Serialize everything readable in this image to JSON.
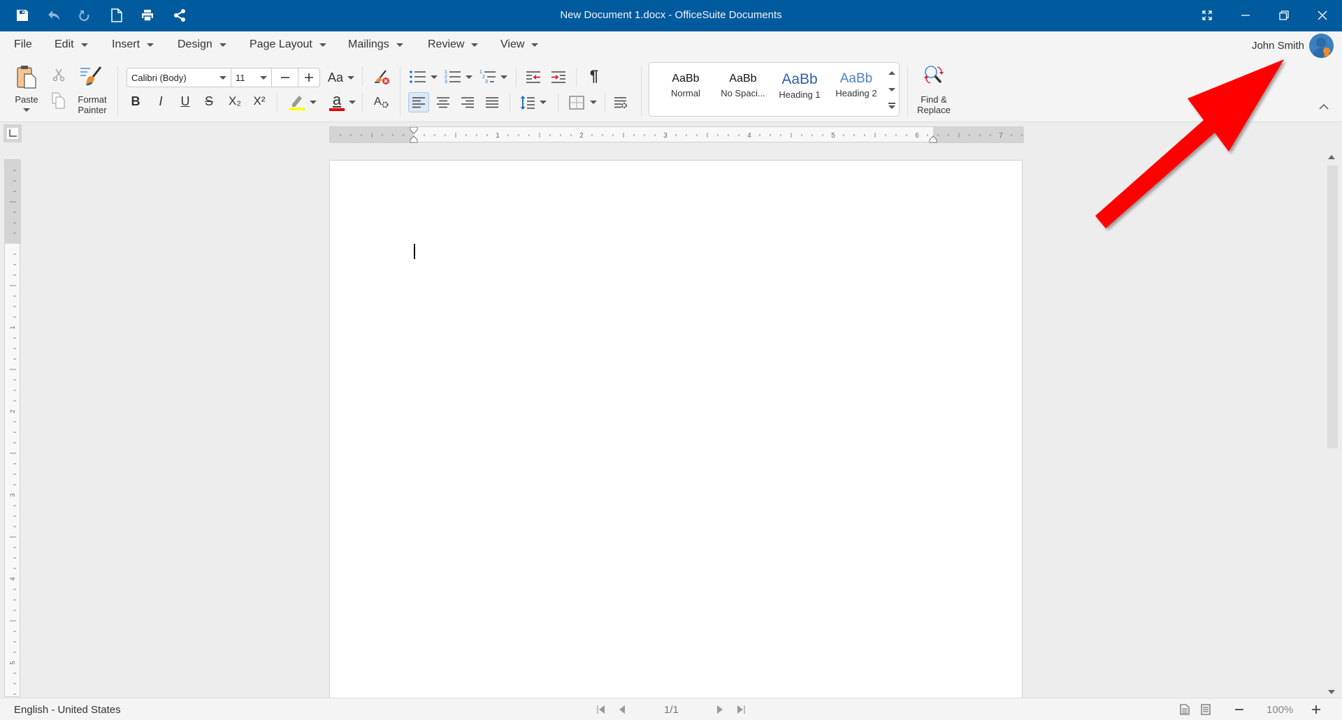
{
  "window": {
    "title": "New Document 1.docx - OfficeSuite Documents",
    "quick_access": [
      "save-icon",
      "undo-icon",
      "redo-icon",
      "new-document-icon",
      "print-icon",
      "share-icon"
    ],
    "controls": [
      "fullscreen-icon",
      "minimize-icon",
      "restore-icon",
      "close-icon"
    ],
    "colors": {
      "titlebar": "#005a9e",
      "annotation_arrow": "#ff0000"
    }
  },
  "menu": {
    "items": [
      {
        "label": "File",
        "dropdown": false
      },
      {
        "label": "Edit",
        "dropdown": true
      },
      {
        "label": "Insert",
        "dropdown": true
      },
      {
        "label": "Design",
        "dropdown": true
      },
      {
        "label": "Page Layout",
        "dropdown": true
      },
      {
        "label": "Mailings",
        "dropdown": true
      },
      {
        "label": "Review",
        "dropdown": true
      },
      {
        "label": "View",
        "dropdown": true
      }
    ],
    "user_name": "John Smith"
  },
  "ribbon": {
    "clipboard": {
      "paste_label": "Paste",
      "format_painter_label_line1": "Format",
      "format_painter_label_line2": "Painter"
    },
    "font": {
      "family": "Calibri (Body)",
      "size": "11",
      "case_label": "Aa",
      "buttons": [
        "bold",
        "italic",
        "underline",
        "strikethrough",
        "subscript",
        "superscript"
      ],
      "bold_label": "B",
      "italic_label": "I",
      "underline_label": "U",
      "strike_label": "S",
      "subscript_label": "X₂",
      "superscript_label": "X²",
      "highlight_color": "#ffff00",
      "font_color": "#e00000",
      "font_color_label": "a"
    },
    "paragraph": {
      "pilcrow": "¶",
      "active_alignment": "left"
    },
    "styles": [
      {
        "sample": "AaBb",
        "name": "Normal"
      },
      {
        "sample": "AaBb",
        "name": "No Spaci..."
      },
      {
        "sample": "AaBb",
        "name": "Heading 1"
      },
      {
        "sample": "AaBb",
        "name": "Heading 2"
      }
    ],
    "find_replace_line1": "Find &",
    "find_replace_line2": "Replace"
  },
  "ruler": {
    "labels": [
      "1",
      "2",
      "3",
      "4",
      "5",
      "6",
      "7"
    ]
  },
  "status": {
    "language": "English - United States",
    "page": "1/1",
    "zoom": "100%"
  }
}
